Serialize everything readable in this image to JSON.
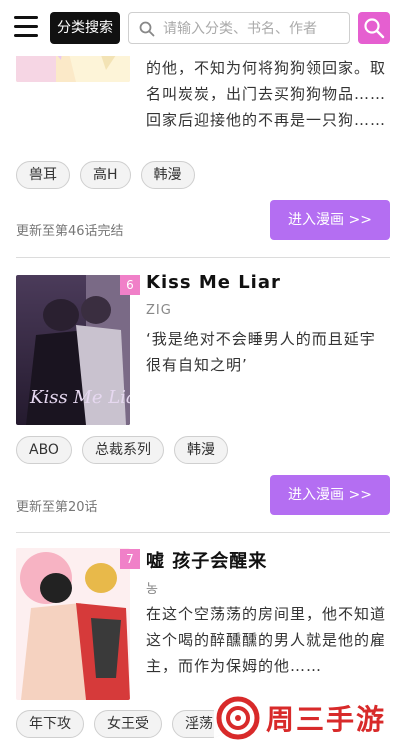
{
  "header": {
    "category_search_label": "分类搜索",
    "search_placeholder": "请输入分类、书名、作者"
  },
  "items": [
    {
      "desc_partial": "的他，不知为何将狗狗领回家。取名叫炭炭，出门去买狗狗物品……回家后迎接他的不再是一只狗……",
      "tags": [
        "兽耳",
        "高H",
        "韩漫"
      ],
      "update": "更新至第46话完结",
      "read_label": "进入漫画 >>"
    },
    {
      "rank": "6",
      "title": "Kiss Me Liar",
      "author": "ZIG",
      "desc": "‘我是绝对不会睡男人的而且延宇很有自知之明’",
      "cover_text": "Kiss Me Liar",
      "tags": [
        "ABO",
        "总裁系列",
        "韩漫"
      ],
      "update": "更新至第20话",
      "read_label": "进入漫画 >>"
    },
    {
      "rank": "7",
      "title": "嘘 孩子会醒来",
      "author": "농",
      "desc": "在这个空荡荡的房间里，他不知道这个喝的醉醺醺的男人就是他的雇主，而作为保姆的他……",
      "tags": [
        "年下攻",
        "女王受",
        "淫荡"
      ]
    }
  ],
  "watermark": {
    "text": "周三手游网"
  },
  "colors": {
    "accent_purple": "#b46ef2",
    "search_pink": "#e55fd0",
    "rank_pink": "#f080c8"
  }
}
